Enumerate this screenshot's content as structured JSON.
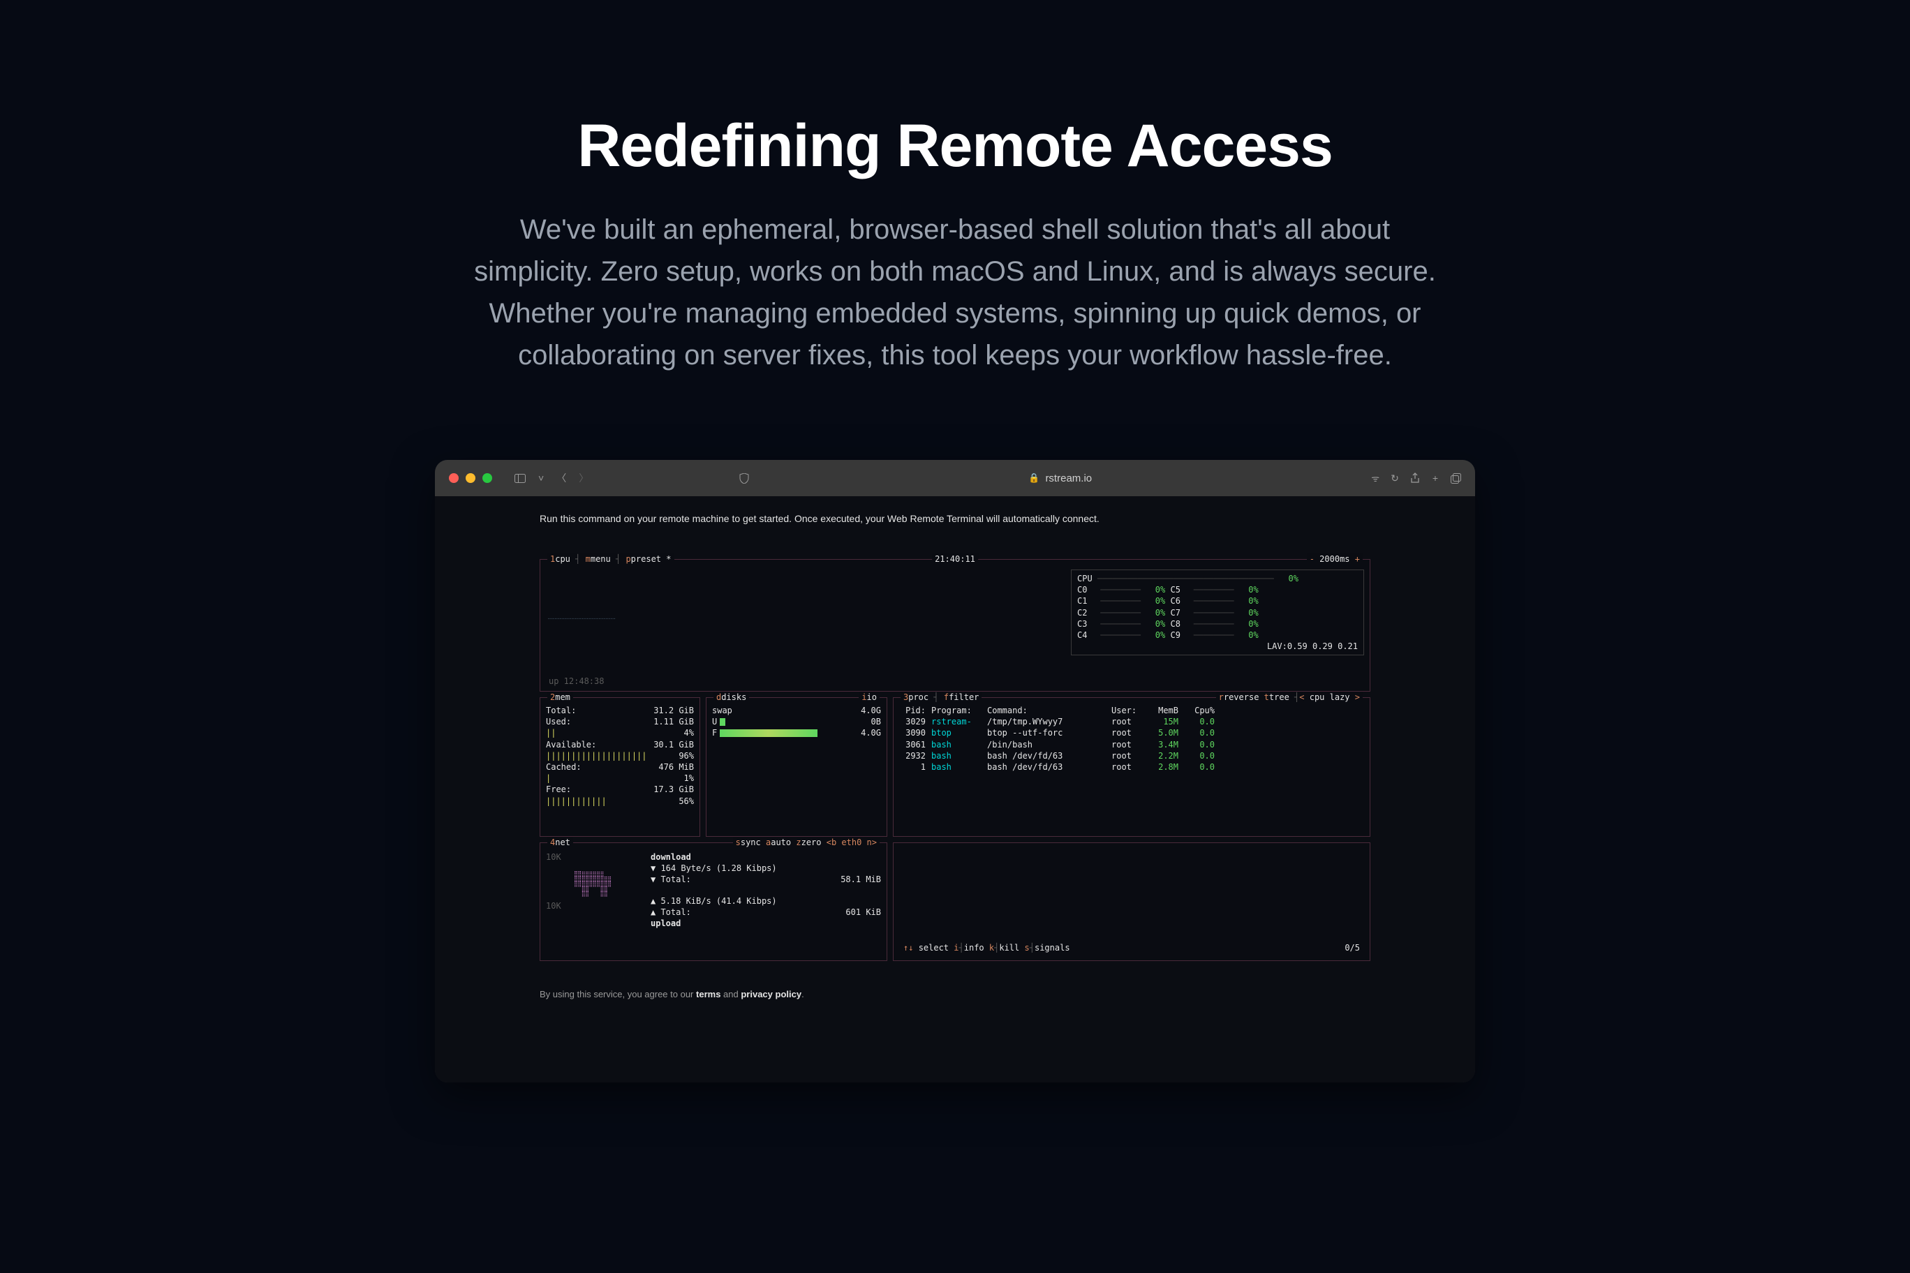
{
  "hero": {
    "title": "Redefining Remote Access",
    "subtitle": "We've built an ephemeral, browser-based shell solution that's all about simplicity. Zero setup, works on both macOS and Linux, and is always secure. Whether you're managing embedded systems, spinning up quick demos, or collaborating on server fixes, this tool keeps your workflow hassle-free."
  },
  "browser": {
    "address": "rstream.io"
  },
  "viewport": {
    "instruction": "Run this command on your remote machine to get started. Once executed, your Web Remote Terminal will automatically connect.",
    "footer_prefix": "By using this service, you agree to our ",
    "footer_terms": "terms",
    "footer_and": " and ",
    "footer_privacy": "privacy policy",
    "footer_period": "."
  },
  "btop": {
    "top": {
      "cpu_label": "cpu",
      "menu_label": "menu",
      "preset_label": "preset",
      "preset_marker": "*",
      "clock": "21:40:11",
      "interval": "2000ms",
      "plus": "+"
    },
    "cpu_box": {
      "label": "CPU",
      "total_pct": "0%",
      "cores": [
        {
          "l": "C0",
          "lp": "0%",
          "r": "C5",
          "rp": "0%"
        },
        {
          "l": "C1",
          "lp": "0%",
          "r": "C6",
          "rp": "0%"
        },
        {
          "l": "C2",
          "lp": "0%",
          "r": "C7",
          "rp": "0%"
        },
        {
          "l": "C3",
          "lp": "0%",
          "r": "C8",
          "rp": "0%"
        },
        {
          "l": "C4",
          "lp": "0%",
          "r": "C9",
          "rp": "0%"
        }
      ],
      "lav_label": "LAV:",
      "lav": "0.59 0.29 0.21"
    },
    "uptime": "up 12:48:38",
    "mem": {
      "title": "mem",
      "total_l": "Total:",
      "total_v": "31.2 GiB",
      "used_l": "Used:",
      "used_v": "1.11 GiB",
      "used_pct": "4%",
      "avail_l": "Available:",
      "avail_v": "30.1 GiB",
      "avail_pct": "96%",
      "cached_l": "Cached:",
      "cached_v": "476 MiB",
      "cached_pct": "1%",
      "free_l": "Free:",
      "free_v": "17.3 GiB",
      "free_pct": "56%"
    },
    "disks": {
      "title": "disks",
      "io": "io",
      "swap_l": "swap",
      "swap_v": "4.0G",
      "u_l": "U",
      "u_v": "0B",
      "f_l": "F",
      "f_v": "4.0G"
    },
    "proc": {
      "title": "proc",
      "filter": "filter",
      "reverse": "reverse",
      "tree": "tree",
      "sort_l": "<",
      "sort_v": "cpu lazy",
      "sort_r": ">",
      "h_pid": "Pid:",
      "h_prog": "Program:",
      "h_cmd": "Command:",
      "h_user": "User:",
      "h_mem": "MemB",
      "h_cpu": "Cpu%",
      "rows": [
        {
          "pid": "3029",
          "prog": "rstream-",
          "cmd": "/tmp/tmp.WYwyy7",
          "user": "root",
          "mem": "15M",
          "cpu": "0.0"
        },
        {
          "pid": "3090",
          "prog": "btop",
          "cmd": "btop --utf-forc",
          "user": "root",
          "mem": "5.0M",
          "cpu": "0.0"
        },
        {
          "pid": "3061",
          "prog": "bash",
          "cmd": "/bin/bash",
          "user": "root",
          "mem": "3.4M",
          "cpu": "0.0"
        },
        {
          "pid": "2932",
          "prog": "bash",
          "cmd": "bash /dev/fd/63",
          "user": "root",
          "mem": "2.2M",
          "cpu": "0.0"
        },
        {
          "pid": "1",
          "prog": "bash",
          "cmd": "bash /dev/fd/63",
          "user": "root",
          "mem": "2.8M",
          "cpu": "0.0"
        }
      ]
    },
    "net": {
      "title": "net",
      "sync": "sync",
      "auto": "auto",
      "zero": "zero",
      "iface": "<b eth0 n>",
      "scale1": "10K",
      "scale2": "10K",
      "dl_l": "download",
      "dl_rate": "▼ 164 Byte/s (1.28 Kibps)",
      "dl_tot_l": "▼ Total:",
      "dl_tot_v": "58.1 MiB",
      "ul_rate": "▲ 5.18 KiB/s (41.4 Kibps)",
      "ul_tot_l": "▲ Total:",
      "ul_tot_v": "601 KiB",
      "ul_l": "upload"
    },
    "select_bar": {
      "select": "select",
      "info_k": "i",
      "info": "info",
      "kill_k": "k",
      "kill": "kill",
      "sig_k": "s",
      "signals": "signals",
      "count": "0/5"
    }
  }
}
